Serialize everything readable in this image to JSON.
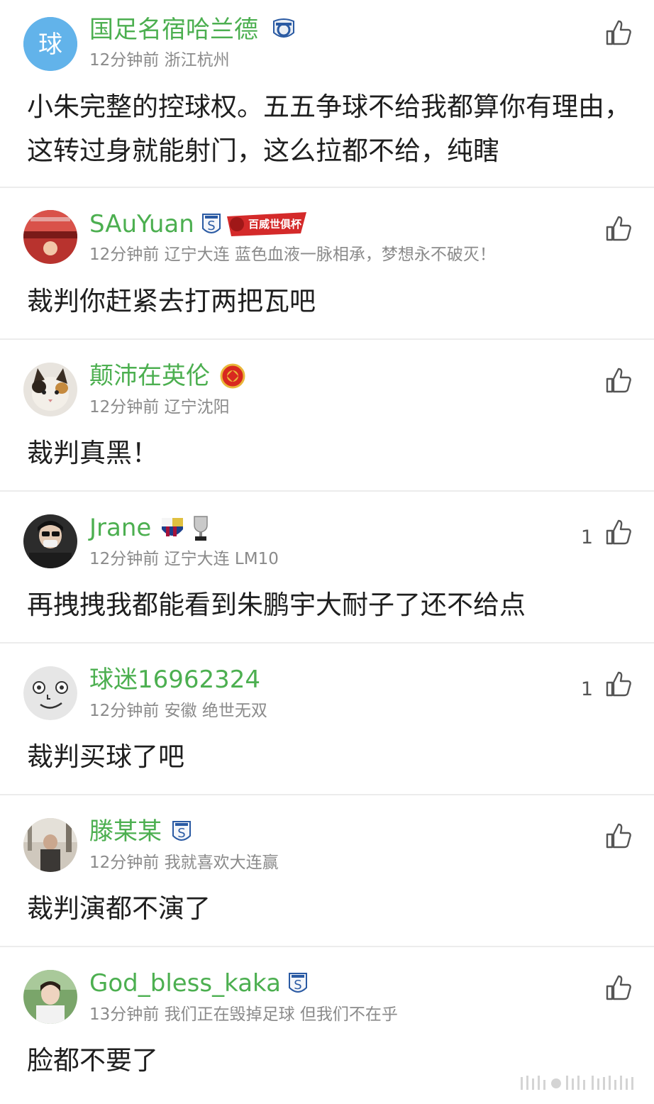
{
  "comments": [
    {
      "username": "国足名宿哈兰德",
      "time": "12分钟前",
      "location": "浙江杭州",
      "signature": "",
      "text": "小朱完整的控球权。五五争球不给我都算你有理由，这转过身就能射门，这么拉都不给，纯瞎",
      "likes": "",
      "avatar_char": "球"
    },
    {
      "username": "SAuYuan",
      "time": "12分钟前",
      "location": "辽宁大连",
      "signature": "蓝色血液一脉相承，梦想永不破灭！",
      "text": "裁判你赶紧去打两把瓦吧",
      "likes": "",
      "badge_text": "百威世俱杯"
    },
    {
      "username": "颠沛在英伦",
      "time": "12分钟前",
      "location": "辽宁沈阳",
      "signature": "",
      "text": "裁判真黑！",
      "likes": ""
    },
    {
      "username": "Jrane",
      "time": "12分钟前",
      "location": "辽宁大连",
      "signature": "LM10",
      "text": "再拽拽我都能看到朱鹏宇大耐子了还不给点",
      "likes": "1"
    },
    {
      "username": "球迷16962324",
      "time": "12分钟前",
      "location": "安徽",
      "signature": "绝世无双",
      "text": "裁判买球了吧",
      "likes": "1"
    },
    {
      "username": "滕某某",
      "time": "12分钟前",
      "location": "",
      "signature": "我就喜欢大连赢",
      "text": "裁判演都不演了",
      "likes": ""
    },
    {
      "username": "God_bless_kaka",
      "time": "13分钟前",
      "location": "",
      "signature": "我们正在毁掉足球 但我们不在乎",
      "text": "脸都不要了",
      "likes": ""
    }
  ],
  "colors": {
    "username": "#4caf50",
    "meta": "#8a8a8a",
    "divider": "#ececec"
  }
}
